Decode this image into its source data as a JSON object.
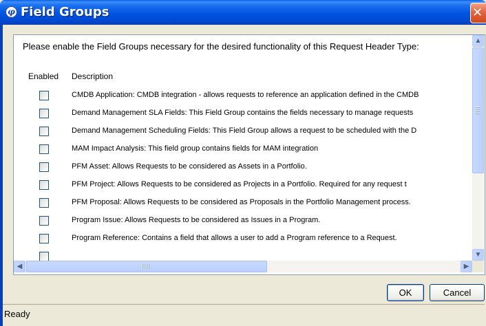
{
  "window": {
    "title": "Field Groups"
  },
  "prompt": "Please enable the Field Groups necessary for the desired functionality of this Request Header Type:",
  "columns": {
    "enabled": "Enabled",
    "description": "Description"
  },
  "rows": [
    {
      "description": "CMDB Application:  CMDB integration - allows requests to reference an application defined in the CMDB",
      "checked": false
    },
    {
      "description": "Demand Management SLA Fields:  This Field Group contains the fields necessary to manage requests",
      "checked": false
    },
    {
      "description": "Demand Management Scheduling Fields:  This Field Group allows a request to be scheduled with the D",
      "checked": false
    },
    {
      "description": "MAM Impact Analysis:  This field group contains fields for MAM integration",
      "checked": false
    },
    {
      "description": "PFM Asset:  Allows Requests to be considered as Assets in a Portfolio.",
      "checked": false
    },
    {
      "description": "PFM Project:  Allows Requests to be considered as Projects in a Portfolio.  Required for any request t",
      "checked": false
    },
    {
      "description": "PFM Proposal:  Allows Requests to be considered as Proposals in the Portfolio Management process.",
      "checked": false
    },
    {
      "description": "Program Issue:  Allows Requests to be considered as Issues in a Program.",
      "checked": false
    },
    {
      "description": "Program Reference:  Contains a field that allows a user to add a Program reference to a Request.",
      "checked": false
    },
    {
      "description": "",
      "checked": false
    }
  ],
  "buttons": {
    "ok": "OK",
    "cancel": "Cancel"
  },
  "status": "Ready",
  "icons": {
    "app": "hp-logo-icon",
    "close": "close-icon",
    "scroll_up": "arrow-up-icon",
    "scroll_down": "arrow-down-icon",
    "scroll_left": "arrow-left-icon",
    "scroll_right": "arrow-right-icon"
  },
  "glyphs": {
    "app": "φ",
    "close": "✕",
    "up": "▲",
    "down": "▼",
    "left": "◀",
    "right": "▶"
  }
}
